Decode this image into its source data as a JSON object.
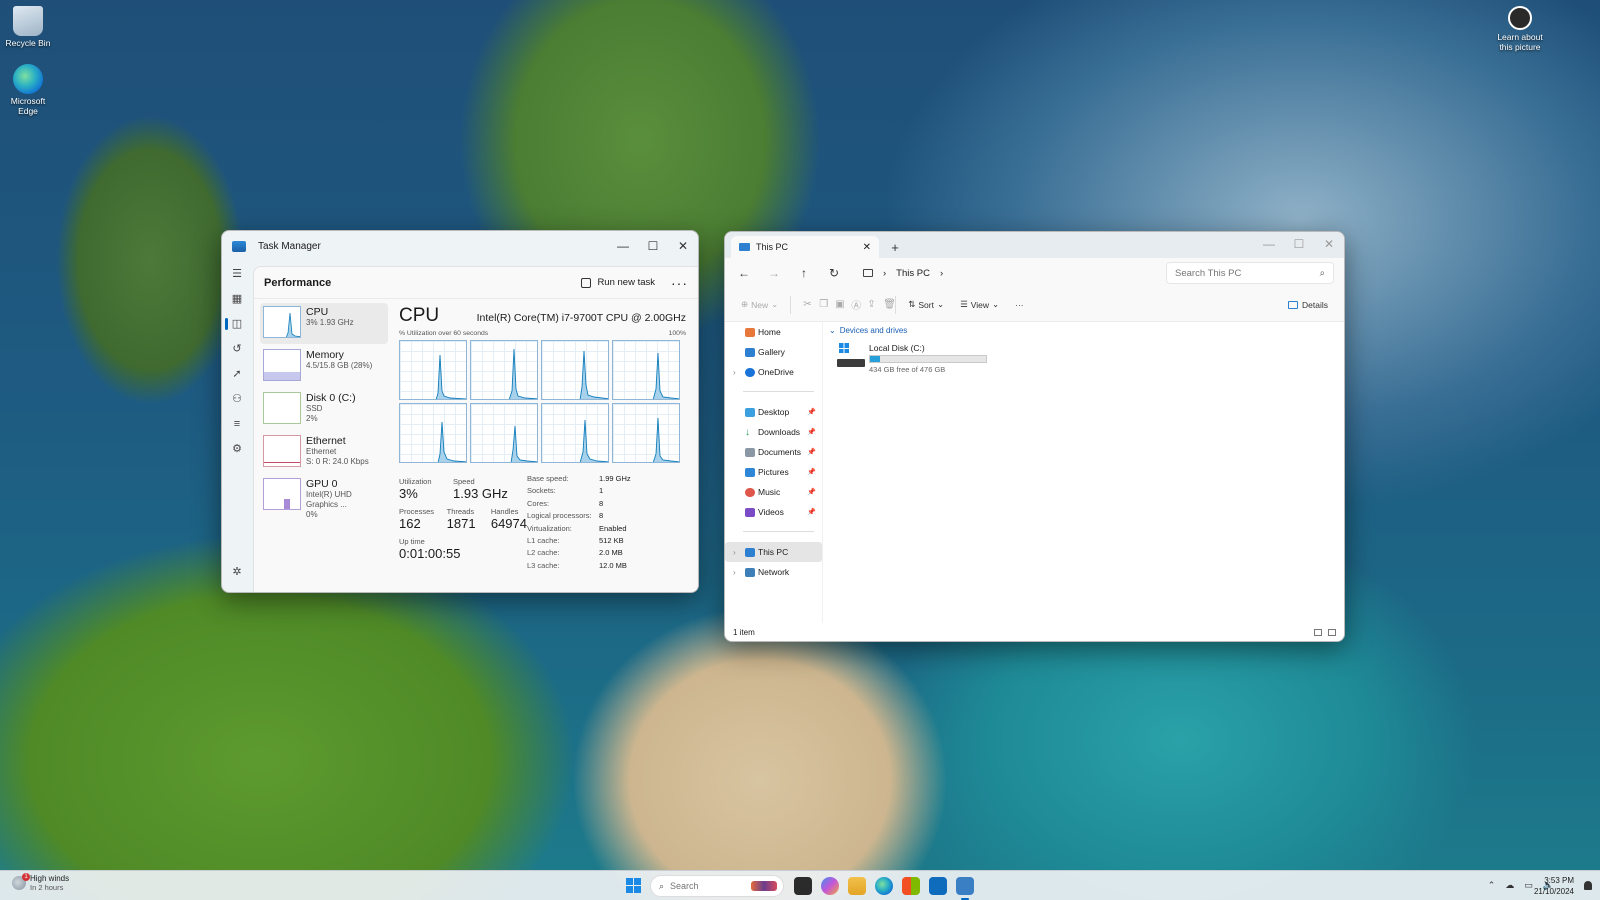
{
  "desktop": {
    "icons": [
      {
        "label": "Recycle Bin",
        "icon": "recycle-bin-icon"
      },
      {
        "label": "Microsoft Edge",
        "icon": "edge-icon"
      },
      {
        "label": "Learn about this picture",
        "icon": "learn-about-picture-icon"
      }
    ]
  },
  "task_manager": {
    "title": "Task Manager",
    "section": "Performance",
    "run_new_task": "Run new task",
    "more": "···",
    "items": [
      {
        "name": "CPU",
        "sub1": "3%  1.93 GHz",
        "sub2": ""
      },
      {
        "name": "Memory",
        "sub1": "4.5/15.8 GB (28%)",
        "sub2": ""
      },
      {
        "name": "Disk 0 (C:)",
        "sub1": "SSD",
        "sub2": "2%"
      },
      {
        "name": "Ethernet",
        "sub1": "Ethernet",
        "sub2": "S: 0  R: 24.0 Kbps"
      },
      {
        "name": "GPU 0",
        "sub1": "Intel(R) UHD Graphics ...",
        "sub2": "0%"
      }
    ],
    "detail": {
      "title": "CPU",
      "model": "Intel(R) Core(TM) i7-9700T CPU @ 2.00GHz",
      "util_label": "% Utilization over 60 seconds",
      "util_max": "100%",
      "utilization_label": "Utilization",
      "utilization": "3%",
      "speed_label": "Speed",
      "speed": "1.93 GHz",
      "processes_label": "Processes",
      "processes": "162",
      "threads_label": "Threads",
      "threads": "1871",
      "handles_label": "Handles",
      "handles": "64974",
      "uptime_label": "Up time",
      "uptime": "0:01:00:55",
      "specs": [
        {
          "k": "Base speed:",
          "v": "1.99 GHz"
        },
        {
          "k": "Sockets:",
          "v": "1"
        },
        {
          "k": "Cores:",
          "v": "8"
        },
        {
          "k": "Logical processors:",
          "v": "8"
        },
        {
          "k": "Virtualization:",
          "v": "Enabled"
        },
        {
          "k": "L1 cache:",
          "v": "512 KB"
        },
        {
          "k": "L2 cache:",
          "v": "2.0 MB"
        },
        {
          "k": "L3 cache:",
          "v": "12.0 MB"
        }
      ]
    }
  },
  "explorer": {
    "tab_title": "This PC",
    "breadcrumb": "This PC",
    "search_placeholder": "Search This PC",
    "commands": {
      "new": "New",
      "sort": "Sort",
      "view": "View",
      "details": "Details"
    },
    "nav": {
      "home": "Home",
      "gallery": "Gallery",
      "onedrive": "OneDrive",
      "desktop": "Desktop",
      "downloads": "Downloads",
      "documents": "Documents",
      "pictures": "Pictures",
      "music": "Music",
      "videos": "Videos",
      "this_pc": "This PC",
      "network": "Network"
    },
    "group": "Devices and drives",
    "drive": {
      "name": "Local Disk (C:)",
      "free": "434 GB free of 476 GB",
      "used_fraction": 0.088
    },
    "status": "1 item"
  },
  "taskbar": {
    "weather_main": "High winds",
    "weather_sub": "In 2 hours",
    "weather_badge": "1",
    "search_placeholder": "Search",
    "time": "3:53 PM",
    "date": "21/10/2024"
  },
  "colors": {
    "accent": "#0067c0",
    "cpu_line": "#117dbb",
    "cpu_fill": "#a8d2eb"
  }
}
